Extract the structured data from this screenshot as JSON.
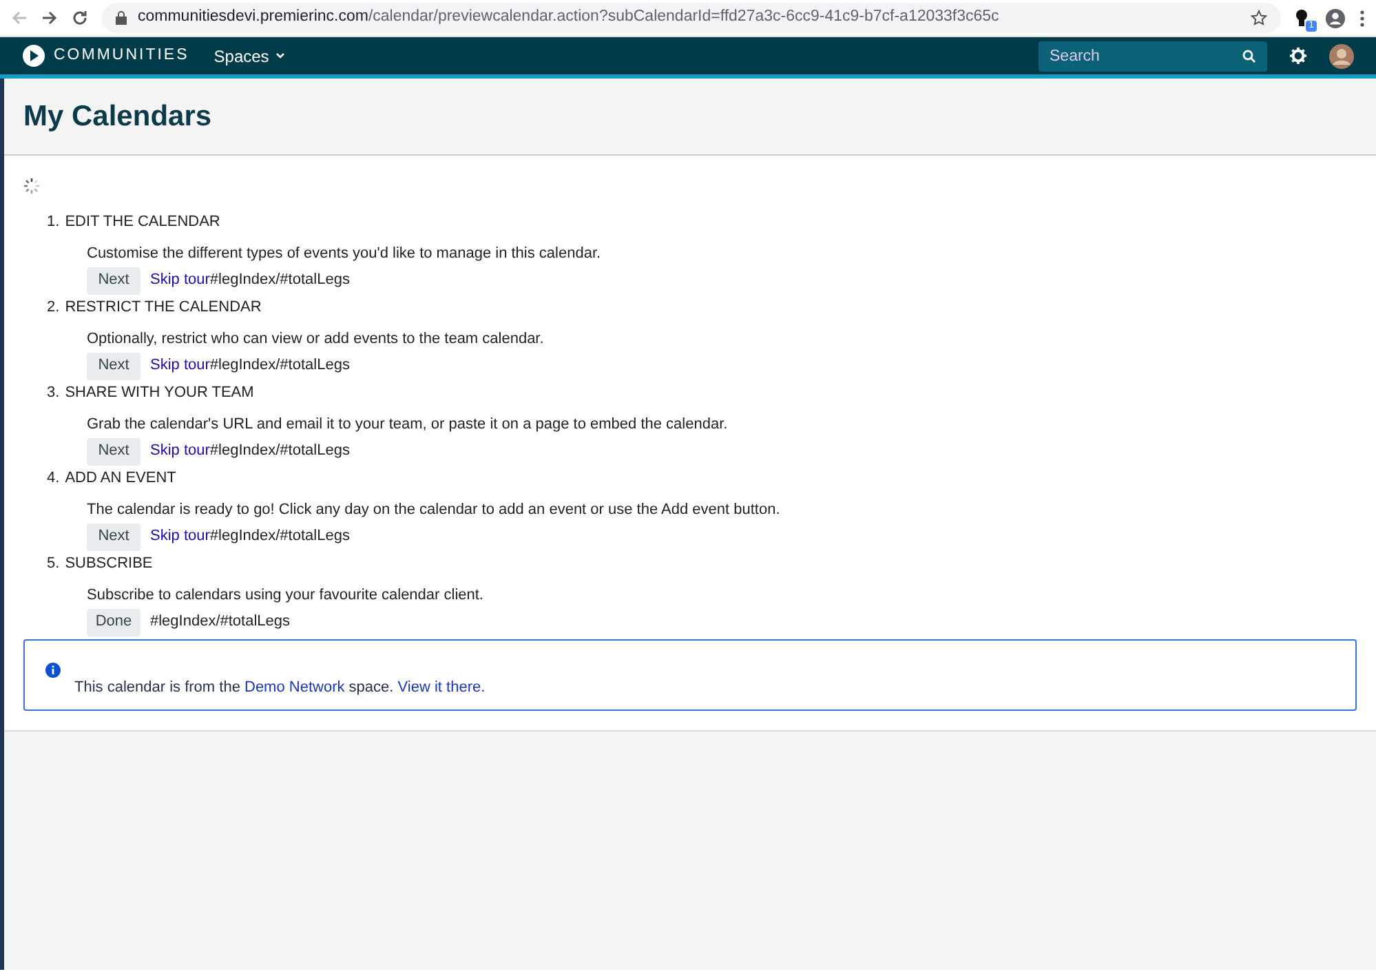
{
  "browser": {
    "url_host": "communitiesdevi.premierinc.com",
    "url_path": "/calendar/previewcalendar.action?subCalendarId=ffd27a3c-6cc9-41c9-b7cf-a12033f3c65c",
    "extension_badge": "1"
  },
  "navbar": {
    "brand": "COMMUNITIES",
    "menu": "Spaces",
    "search": {
      "placeholder": "Search"
    }
  },
  "page": {
    "title": "My Calendars"
  },
  "tour_steps": [
    {
      "number": "1.",
      "title": "EDIT THE CALENDAR",
      "description": "Customise the different types of events you'd like to manage in this calendar.",
      "button": "Next",
      "skip": "Skip tour",
      "counter": "#legIndex/#totalLegs"
    },
    {
      "number": "2.",
      "title": "RESTRICT THE CALENDAR",
      "description": "Optionally, restrict who can view or add events to the team calendar.",
      "button": "Next",
      "skip": "Skip tour",
      "counter": "#legIndex/#totalLegs"
    },
    {
      "number": "3.",
      "title": "SHARE WITH YOUR TEAM",
      "description": "Grab the calendar's URL and email it to your team, or paste it on a page to embed the calendar.",
      "button": "Next",
      "skip": "Skip tour",
      "counter": "#legIndex/#totalLegs"
    },
    {
      "number": "4.",
      "title": "ADD AN EVENT",
      "description": "The calendar is ready to go! Click any day on the calendar to add an event or use the Add event button.",
      "button": "Next",
      "skip": "Skip tour",
      "counter": "#legIndex/#totalLegs"
    },
    {
      "number": "5.",
      "title": "SUBSCRIBE",
      "description": "Subscribe to calendars using your favourite calendar client.",
      "button": "Done",
      "counter": "#legIndex/#totalLegs"
    }
  ],
  "info_message": {
    "text_before": "This calendar is from the ",
    "space_link": "Demo Network",
    "text_middle": " space. ",
    "view_link": "View it there."
  }
}
